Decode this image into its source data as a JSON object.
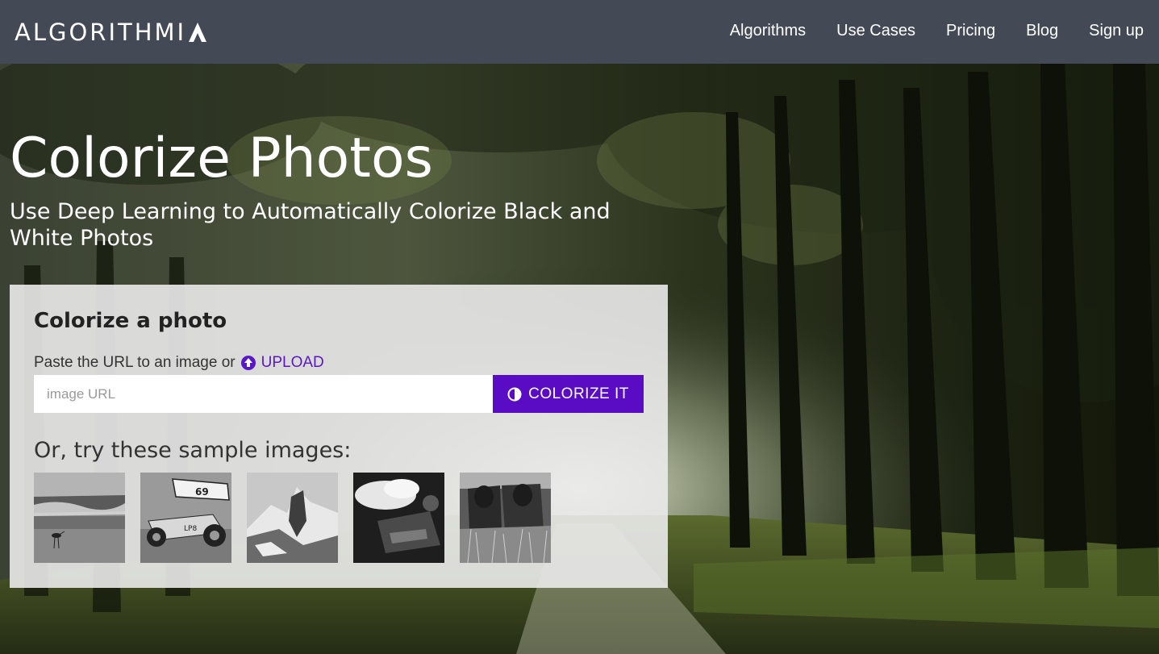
{
  "header": {
    "logo_text": "ALGORITHMI",
    "logo_suffix_icon": "a-triangle-logo-mark",
    "nav": [
      {
        "label": "Algorithms"
      },
      {
        "label": "Use Cases"
      },
      {
        "label": "Pricing"
      },
      {
        "label": "Blog"
      },
      {
        "label": "Sign up"
      }
    ]
  },
  "hero": {
    "title": "Colorize Photos",
    "subtitle": "Use Deep Learning to Automatically Colorize Black and White Photos",
    "background": "forest-road-photo"
  },
  "panel": {
    "title": "Colorize a photo",
    "instruction": "Paste the URL to an image or",
    "upload_label": "UPLOAD",
    "upload_icon": "upload-circle-icon",
    "url_placeholder": "image URL",
    "url_value": "",
    "colorize_label": "COLORIZE IT",
    "colorize_icon": "contrast-icon",
    "samples_heading": "Or, try these sample images:",
    "samples": [
      {
        "subject": "shorebird-on-beach"
      },
      {
        "subject": "sprint-race-car"
      },
      {
        "subject": "mountain-peak"
      },
      {
        "subject": "fire-breather"
      },
      {
        "subject": "cows-in-grass"
      }
    ]
  },
  "colors": {
    "header_bg": "#434a55",
    "accent": "#5a0cc4",
    "upload_link": "#5a17c7",
    "panel_bg": "#ebebeb"
  }
}
